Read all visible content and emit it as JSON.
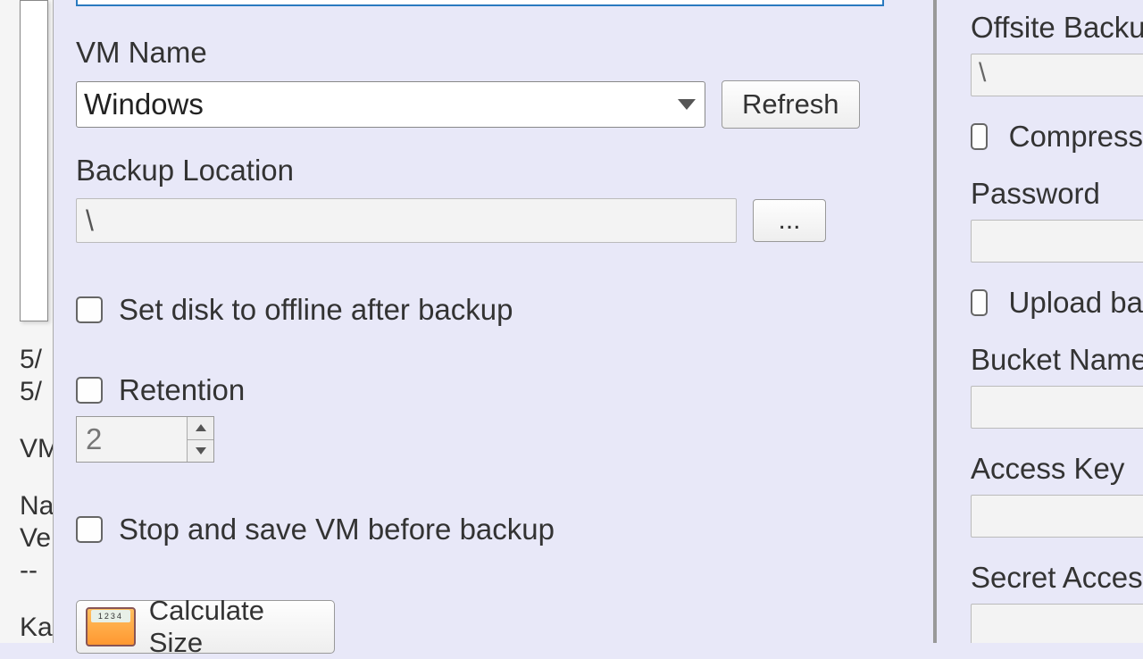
{
  "background": {
    "line1": "5/",
    "line2": "5/",
    "line3": "VM",
    "line4": "Na",
    "line5": "Ve",
    "line6": "--",
    "line7": "Ka"
  },
  "main": {
    "vm_name_label": "VM Name",
    "vm_name_value": "Windows",
    "refresh_label": "Refresh",
    "backup_location_label": "Backup Location",
    "backup_location_value": "\\",
    "browse_label": "...",
    "offline_label": "Set disk to offline after backup",
    "retention_label": "Retention",
    "retention_value": "2",
    "stopsave_label": "Stop and save VM before backup",
    "calculate_label": "Calculate Size"
  },
  "right": {
    "offsite_label": "Offsite Backup",
    "offsite_value": "\\",
    "compress_label": "Compress",
    "password_label": "Password",
    "upload_label": "Upload ba",
    "bucket_label": "Bucket Name",
    "access_key_label": "Access Key",
    "secret_key_label": "Secret Access K"
  }
}
